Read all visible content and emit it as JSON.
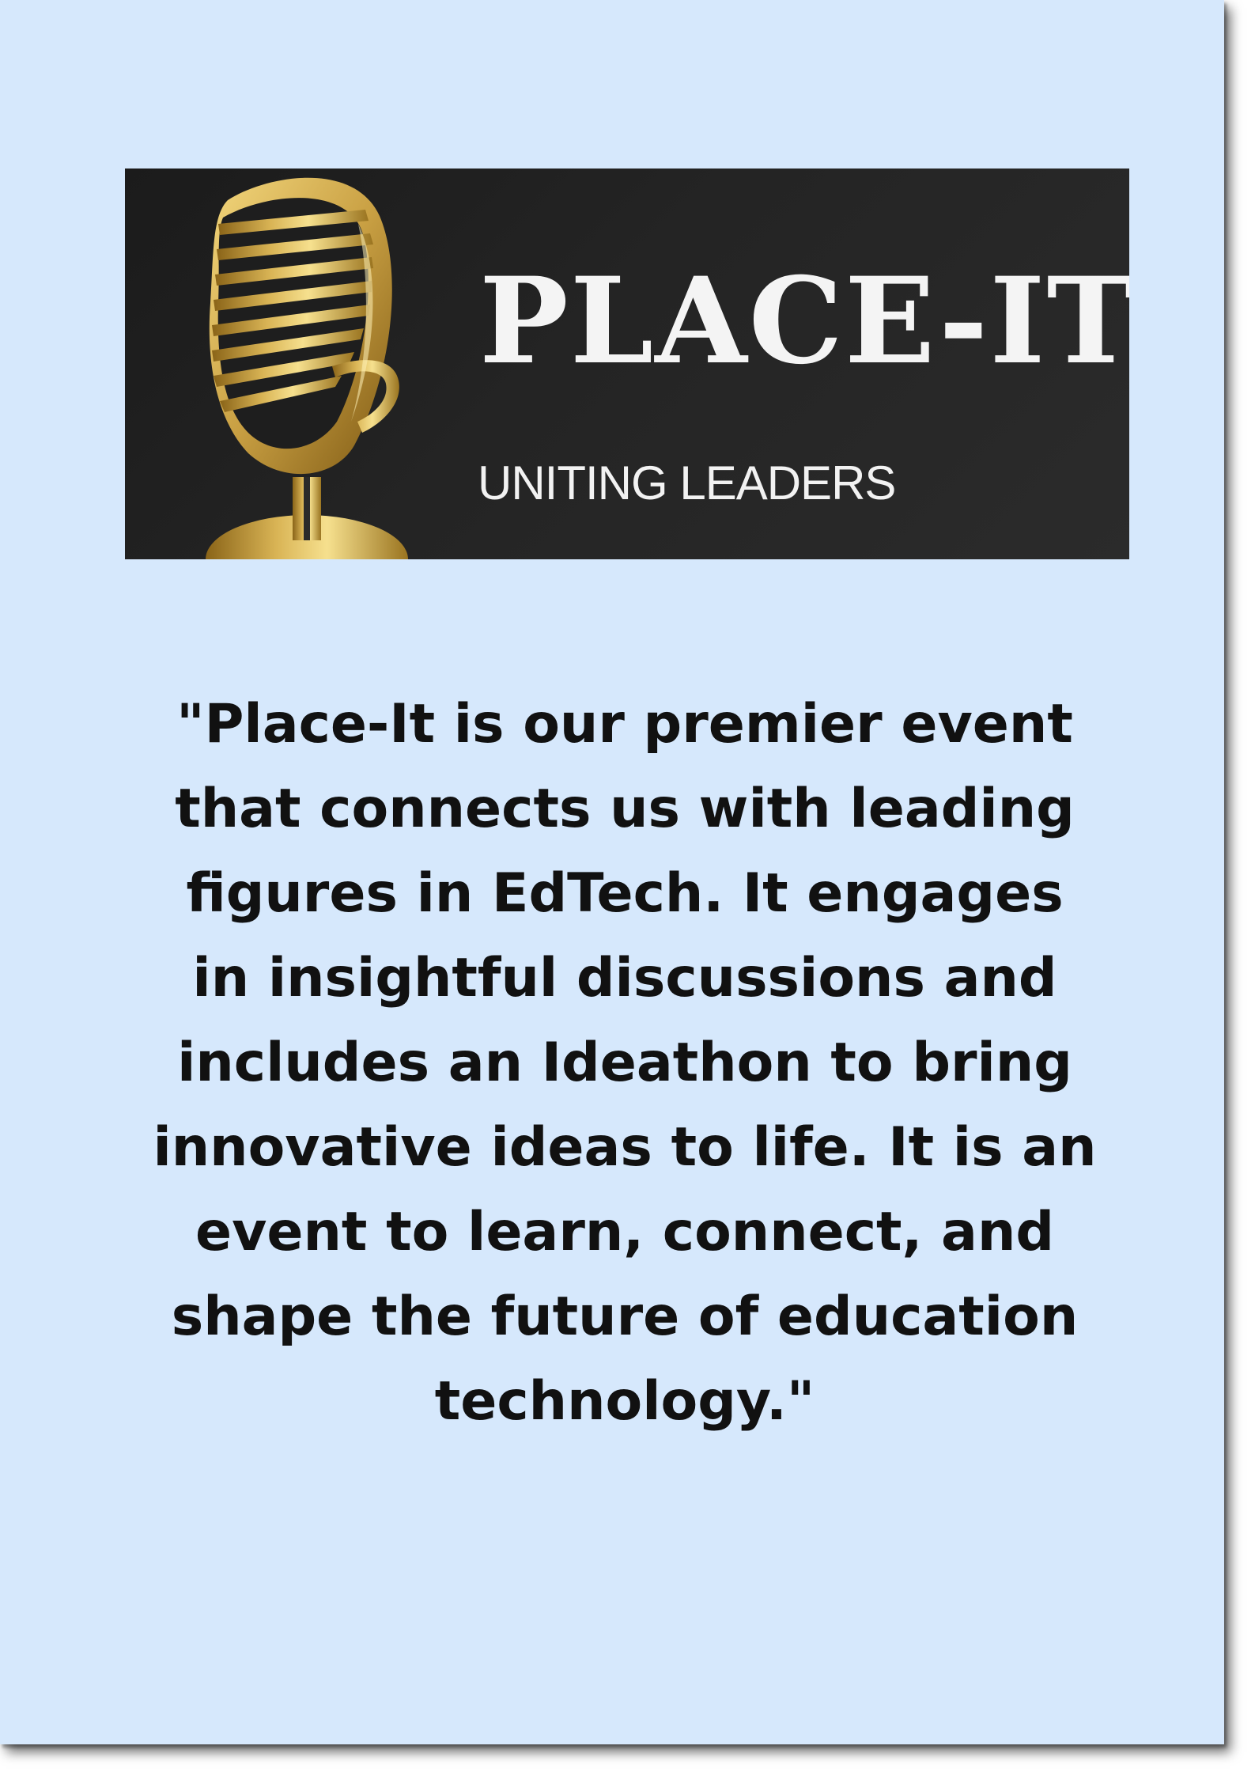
{
  "logo": {
    "name": "PLACE-IT",
    "tagline": "UNITING LEADERS",
    "icon": "microphone-icon",
    "colors": {
      "background": "#222222",
      "gold_dark": "#9a7420",
      "gold_light": "#f6dd8a",
      "text": "#f4f4f4"
    }
  },
  "quote": {
    "text": "\"Place-It is our premier event that connects us with leading figures in EdTech. It engages in insightful discussions and includes an Ideathon to bring innovative ideas to life. It is an event to learn, connect, and shape the future of education technology.\""
  },
  "colors": {
    "page_background": "#d6e8fc",
    "quote_text": "#111111"
  }
}
